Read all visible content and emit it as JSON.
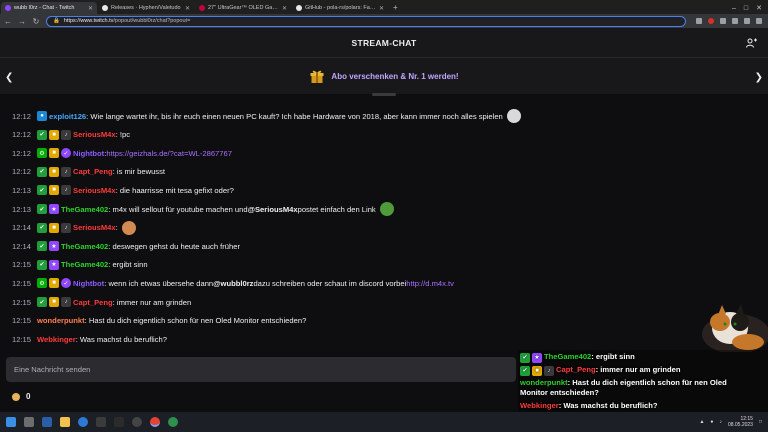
{
  "browser": {
    "tabs": [
      {
        "title": "wubb l0rz - Chat - Twitch",
        "favicon_color": "#9147ff",
        "active": true
      },
      {
        "title": "Releases · Hyphen/Valetudo",
        "favicon_color": "#e8e8e8",
        "active": false
      },
      {
        "title": "27\" UltraGear™ OLED Gaming M...",
        "favicon_color": "#c4003b",
        "active": false
      },
      {
        "title": "GitHub - pola-rs/polars: Fast mul...",
        "favicon_color": "#e8e8e8",
        "active": false
      }
    ],
    "new_tab": "+",
    "url_host": "https://www.twitch.tv",
    "url_path": "/popout/wubbl0rz/chat?popout="
  },
  "header": {
    "title": "STREAM-CHAT",
    "promo": "Abo verschenken & Nr. 1 werden!"
  },
  "colors": {
    "accent": "#9147ff",
    "link": "#a970ff"
  },
  "messages": [
    {
      "time": "12:12",
      "badges": [
        "blue"
      ],
      "user": "exploit126",
      "color": "#4aa8ff",
      "segments": [
        {
          "t": "text",
          "v": ": Wie lange wartet ihr, bis ihr euch einen neuen PC kauft? Ich habe Hardware von 2018, aber kann immer noch alles spielen"
        }
      ],
      "emote": "#d9d9d9"
    },
    {
      "time": "12:12",
      "badges": [
        "vip",
        "gift",
        "sound"
      ],
      "user": "SeriousM4x",
      "color": "#ff3b3b",
      "segments": [
        {
          "t": "text",
          "v": ": !pc"
        }
      ]
    },
    {
      "time": "12:12",
      "badges": [
        "mod",
        "gift",
        "bot"
      ],
      "user": "Nightbot",
      "color": "#8a5cff",
      "segments": [
        {
          "t": "text",
          "v": ": "
        },
        {
          "t": "link",
          "v": "https://geizhals.de/?cat=WL-2867767"
        }
      ]
    },
    {
      "time": "12:12",
      "badges": [
        "vip",
        "gift",
        "sound"
      ],
      "user": "Capt_Peng",
      "color": "#ff3b3b",
      "segments": [
        {
          "t": "text",
          "v": ": is mir bewusst"
        }
      ]
    },
    {
      "time": "12:13",
      "badges": [
        "vip",
        "gift",
        "sound"
      ],
      "user": "SeriousM4x",
      "color": "#ff3b3b",
      "segments": [
        {
          "t": "text",
          "v": ": die haarrisse mit tesa gefixt oder?"
        }
      ]
    },
    {
      "time": "12:13",
      "badges": [
        "vip",
        "sub"
      ],
      "user": "TheGame402",
      "color": "#2fd12f",
      "segments": [
        {
          "t": "text",
          "v": ": m4x will sellout für youtube machen und "
        },
        {
          "t": "mention",
          "v": "@SeriousM4x"
        },
        {
          "t": "text",
          "v": " postet einfach den Link"
        }
      ],
      "emote": "#4f9a3a"
    },
    {
      "time": "12:14",
      "badges": [
        "vip",
        "gift",
        "sound"
      ],
      "user": "SeriousM4x",
      "color": "#ff3b3b",
      "segments": [
        {
          "t": "text",
          "v": ":"
        }
      ],
      "emote": "#d08a52"
    },
    {
      "time": "12:14",
      "badges": [
        "vip",
        "sub"
      ],
      "user": "TheGame402",
      "color": "#2fd12f",
      "segments": [
        {
          "t": "text",
          "v": ": deswegen gehst du heute auch früher"
        }
      ]
    },
    {
      "time": "12:15",
      "badges": [
        "vip",
        "sub"
      ],
      "user": "TheGame402",
      "color": "#2fd12f",
      "segments": [
        {
          "t": "text",
          "v": ": ergibt sinn"
        }
      ]
    },
    {
      "time": "12:15",
      "badges": [
        "mod",
        "gift",
        "bot"
      ],
      "user": "Nightbot",
      "color": "#8a5cff",
      "segments": [
        {
          "t": "text",
          "v": ": wenn ich etwas übersehe dann "
        },
        {
          "t": "mention",
          "v": "@wubbl0rz"
        },
        {
          "t": "text",
          "v": " dazu schreiben oder schaut im discord vorbei "
        },
        {
          "t": "link",
          "v": "http://d.m4x.tv"
        }
      ]
    },
    {
      "time": "12:15",
      "badges": [
        "vip",
        "gift",
        "sound"
      ],
      "user": "Capt_Peng",
      "color": "#ff3b3b",
      "segments": [
        {
          "t": "text",
          "v": ": immer nur am grinden"
        }
      ]
    },
    {
      "time": "12:15",
      "badges": [],
      "user": "wonderpunkt",
      "color": "#ff7f50",
      "segments": [
        {
          "t": "text",
          "v": ": Hast du dich eigentlich schon für nen Oled Monitor entschieden?"
        }
      ]
    },
    {
      "time": "12:15",
      "badges": [],
      "user": "Webkinger",
      "color": "#ff3b3b",
      "segments": [
        {
          "t": "text",
          "v": ": Was machst du beruflich?"
        }
      ]
    }
  ],
  "input": {
    "placeholder": "Eine Nachricht senden"
  },
  "points": {
    "value": "0"
  },
  "overlay": {
    "messages": [
      {
        "badges": [
          "vip",
          "sub"
        ],
        "user": "TheGame402",
        "color": "#2fd12f",
        "text": ": ergibt sinn"
      },
      {
        "badges": [
          "vip",
          "gift",
          "sound"
        ],
        "user": "Capt_Peng",
        "color": "#ff3b3b",
        "text": ": immer nur am grinden"
      },
      {
        "badges": [],
        "user": "wonderpunkt",
        "color": "#2fd12f",
        "text": ": Hast du dich eigentlich schon für nen Oled Monitor entschieden?"
      },
      {
        "badges": [],
        "user": "Webkinger",
        "color": "#ff3b3b",
        "text": ": Was machst du beruflich?"
      }
    ]
  },
  "taskbar": {
    "time": "12:15",
    "date": "08.05.2023"
  }
}
